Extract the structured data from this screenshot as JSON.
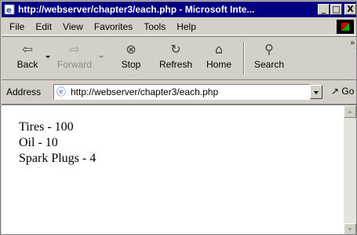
{
  "window": {
    "title": "http://webserver/chapter3/each.php - Microsoft Inte...",
    "controls": [
      "_",
      "□",
      "X"
    ]
  },
  "menu": {
    "items": [
      "File",
      "Edit",
      "View",
      "Favorites",
      "Tools",
      "Help"
    ]
  },
  "toolbar": {
    "back": "Back",
    "forward": "Forward",
    "stop": "Stop",
    "refresh": "Refresh",
    "home": "Home",
    "search": "Search",
    "more": "»"
  },
  "address": {
    "label": "Address",
    "url": "http://webserver/chapter3/each.php",
    "go": "Go"
  },
  "page": {
    "lines": [
      "Tires - 100",
      "Oil - 10",
      "Spark Plugs - 4"
    ]
  },
  "icons": {
    "app": "ie-page-icon",
    "back": "back-arrow-icon",
    "forward": "forward-arrow-icon",
    "stop": "stop-icon",
    "refresh": "refresh-icon",
    "home": "home-icon",
    "search": "search-icon"
  }
}
